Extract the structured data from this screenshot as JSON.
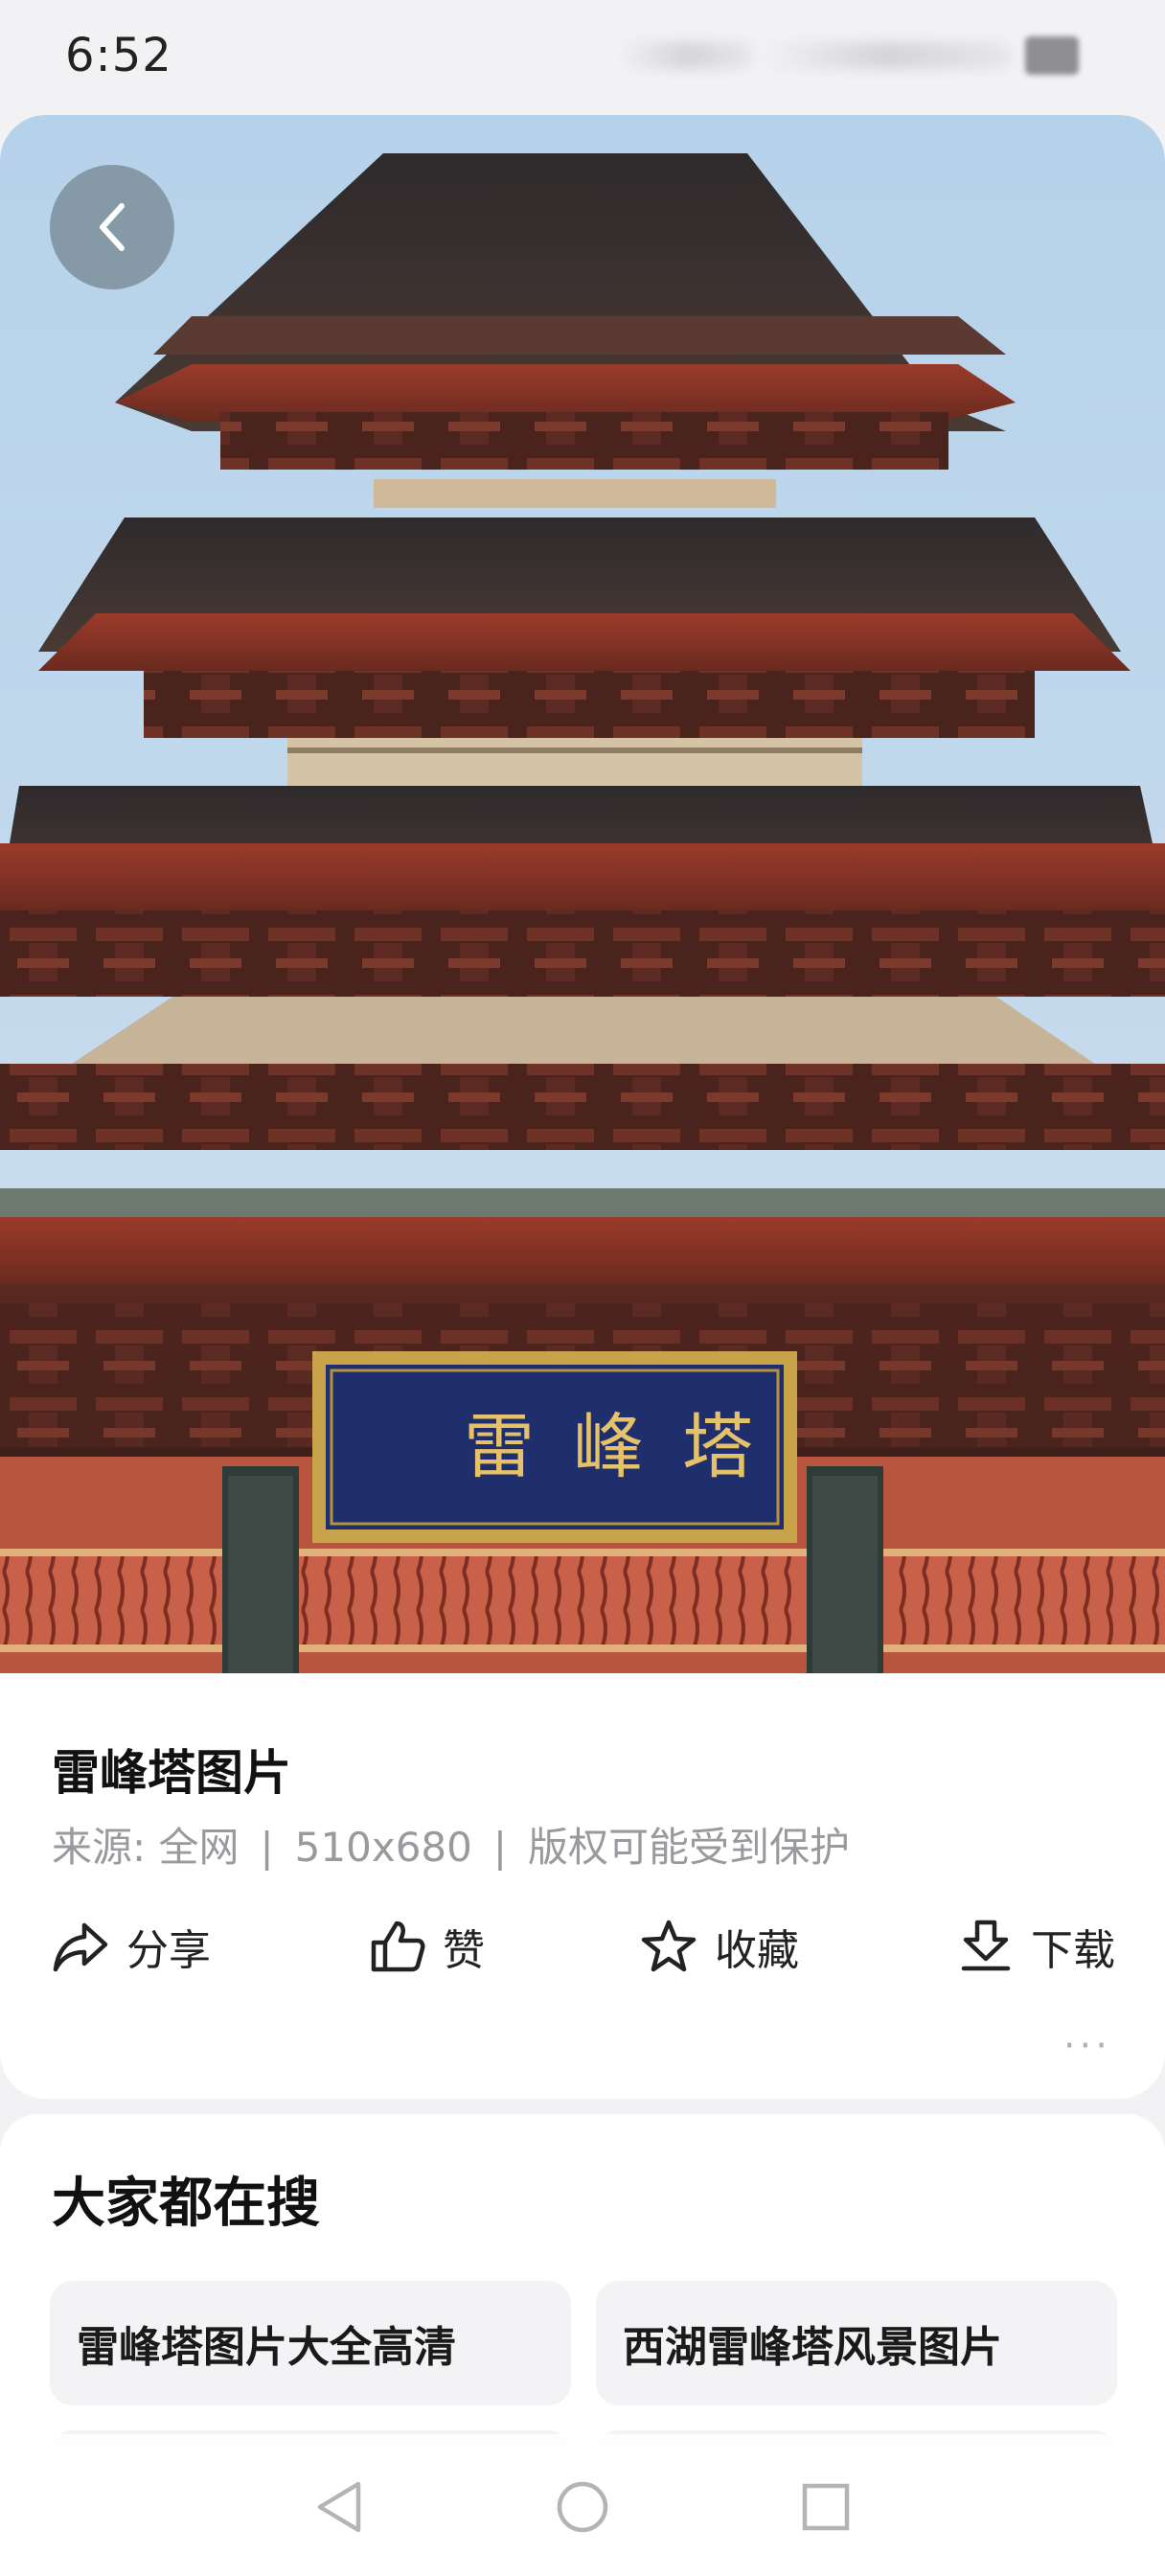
{
  "status_bar": {
    "time": "6:52"
  },
  "image": {
    "plaque_text": "雷峰塔",
    "title": "雷峰塔图片",
    "meta": {
      "source": "来源: 全网",
      "dimensions": "510x680",
      "copyright": "版权可能受到保护",
      "separator": "|"
    }
  },
  "actions": {
    "share": "分享",
    "like": "赞",
    "favorite": "收藏",
    "download": "下载",
    "more": "···"
  },
  "search_section": {
    "title": "大家都在搜",
    "chips": [
      "雷峰塔图片大全高清",
      "西湖雷峰塔风景图片"
    ]
  },
  "icons": {
    "back": "back-chevron-icon",
    "share": "share-arrow-icon",
    "like": "thumbs-up-icon",
    "favorite": "star-icon",
    "download": "download-tray-icon",
    "nav_back": "triangle-back-icon",
    "nav_home": "circle-home-icon",
    "nav_recent": "square-recents-icon"
  },
  "colors": {
    "accent_gold": "#c8a34a",
    "plaque_blue": "#1f2f6e",
    "sky": "#b8d4ec",
    "wood_red": "#8a3324"
  }
}
